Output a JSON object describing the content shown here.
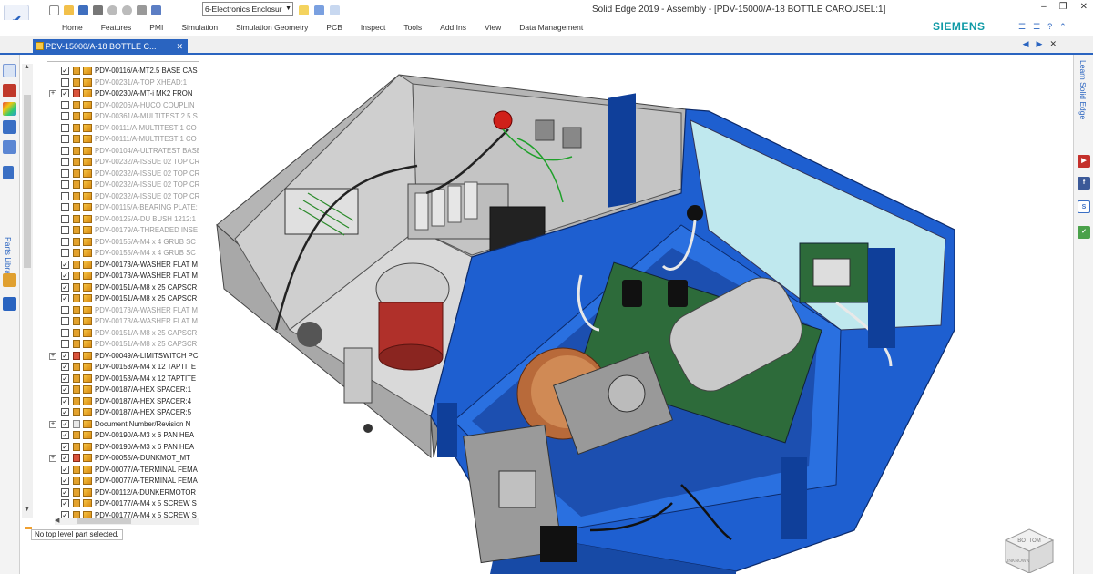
{
  "app": {
    "window_title": "Solid Edge 2019 - Assembly - [PDV-15000/A-18 BOTTLE CAROUSEL:1]",
    "brand": "SIEMENS",
    "environment_select": "6-Electronics Enclosur"
  },
  "ribbon": {
    "tabs": [
      "Home",
      "Features",
      "PMI",
      "Simulation",
      "Simulation Geometry",
      "PCB",
      "Inspect",
      "Tools",
      "Add Ins",
      "View",
      "Data Management"
    ]
  },
  "document_tab": {
    "label": "PDV-15000/A-18 BOTTLE C..."
  },
  "left_panel": {
    "parts_library_label": "Parts Library"
  },
  "right_panel": {
    "learn_label": "Learn Solid Edge"
  },
  "pathfinder": {
    "rows": [
      {
        "label": "PDV-00116/A-MT2.5 BASE CAS",
        "checked": true,
        "gray": false,
        "icon": "part",
        "expand": ""
      },
      {
        "label": "PDV-00231/A-TOP XHEAD:1",
        "checked": false,
        "gray": true,
        "icon": "part",
        "expand": ""
      },
      {
        "label": "PDV-00230/A-MT-i MK2 FRON",
        "checked": true,
        "gray": false,
        "icon": "asm",
        "expand": "+"
      },
      {
        "label": "PDV-00206/A-HUCO COUPLIN",
        "checked": false,
        "gray": true,
        "icon": "part",
        "expand": ""
      },
      {
        "label": "PDV-00361/A-MULTITEST 2.5 S",
        "checked": false,
        "gray": true,
        "icon": "part",
        "expand": ""
      },
      {
        "label": "PDV-00111/A-MULTITEST 1 CO",
        "checked": false,
        "gray": true,
        "icon": "part",
        "expand": ""
      },
      {
        "label": "PDV-00111/A-MULTITEST 1 CO",
        "checked": false,
        "gray": true,
        "icon": "part",
        "expand": ""
      },
      {
        "label": "PDV-00104/A-ULTRATEST BASE",
        "checked": false,
        "gray": true,
        "icon": "part",
        "expand": ""
      },
      {
        "label": "PDV-00232/A-ISSUE 02 TOP CR",
        "checked": false,
        "gray": true,
        "icon": "part",
        "expand": ""
      },
      {
        "label": "PDV-00232/A-ISSUE 02 TOP CR",
        "checked": false,
        "gray": true,
        "icon": "part",
        "expand": ""
      },
      {
        "label": "PDV-00232/A-ISSUE 02 TOP CR",
        "checked": false,
        "gray": true,
        "icon": "part",
        "expand": ""
      },
      {
        "label": "PDV-00232/A-ISSUE 02 TOP CR",
        "checked": false,
        "gray": true,
        "icon": "part",
        "expand": ""
      },
      {
        "label": "PDV-00115/A-BEARING PLATE:",
        "checked": false,
        "gray": true,
        "icon": "part",
        "expand": ""
      },
      {
        "label": "PDV-00125/A-DU BUSH 1212:1",
        "checked": false,
        "gray": true,
        "icon": "part",
        "expand": ""
      },
      {
        "label": "PDV-00179/A-THREADED INSE",
        "checked": false,
        "gray": true,
        "icon": "part",
        "expand": ""
      },
      {
        "label": "PDV-00155/A-M4 x 4 GRUB SC",
        "checked": false,
        "gray": true,
        "icon": "part",
        "expand": ""
      },
      {
        "label": "PDV-00155/A-M4 x 4 GRUB SC",
        "checked": false,
        "gray": true,
        "icon": "part",
        "expand": ""
      },
      {
        "label": "PDV-00173/A-WASHER FLAT M",
        "checked": true,
        "gray": false,
        "icon": "part",
        "expand": ""
      },
      {
        "label": "PDV-00173/A-WASHER FLAT M",
        "checked": true,
        "gray": false,
        "icon": "part",
        "expand": ""
      },
      {
        "label": "PDV-00151/A-M8 x 25 CAPSCR",
        "checked": true,
        "gray": false,
        "icon": "part",
        "expand": ""
      },
      {
        "label": "PDV-00151/A-M8 x 25 CAPSCR",
        "checked": true,
        "gray": false,
        "icon": "part",
        "expand": ""
      },
      {
        "label": "PDV-00173/A-WASHER FLAT M",
        "checked": false,
        "gray": true,
        "icon": "part",
        "expand": ""
      },
      {
        "label": "PDV-00173/A-WASHER FLAT M",
        "checked": false,
        "gray": true,
        "icon": "part",
        "expand": ""
      },
      {
        "label": "PDV-00151/A-M8 x 25 CAPSCR",
        "checked": false,
        "gray": true,
        "icon": "part",
        "expand": ""
      },
      {
        "label": "PDV-00151/A-M8 x 25 CAPSCR",
        "checked": false,
        "gray": true,
        "icon": "part",
        "expand": ""
      },
      {
        "label": "PDV-00049/A-LIMITSWITCH PC",
        "checked": true,
        "gray": false,
        "icon": "asm",
        "expand": "+"
      },
      {
        "label": "PDV-00153/A-M4 x 12 TAPTITE",
        "checked": true,
        "gray": false,
        "icon": "part",
        "expand": ""
      },
      {
        "label": "PDV-00153/A-M4 x 12 TAPTITE",
        "checked": true,
        "gray": false,
        "icon": "part",
        "expand": ""
      },
      {
        "label": "PDV-00187/A-HEX SPACER:1",
        "checked": true,
        "gray": false,
        "icon": "part",
        "expand": ""
      },
      {
        "label": "PDV-00187/A-HEX SPACER:4",
        "checked": true,
        "gray": false,
        "icon": "part",
        "expand": ""
      },
      {
        "label": "PDV-00187/A-HEX SPACER:5",
        "checked": true,
        "gray": false,
        "icon": "part",
        "expand": ""
      },
      {
        "label": "Document Number/Revision N",
        "checked": true,
        "gray": false,
        "icon": "doc",
        "expand": "+"
      },
      {
        "label": "PDV-00190/A-M3 x 6 PAN HEA",
        "checked": true,
        "gray": false,
        "icon": "part",
        "expand": ""
      },
      {
        "label": "PDV-00190/A-M3 x 6 PAN HEA",
        "checked": true,
        "gray": false,
        "icon": "part",
        "expand": ""
      },
      {
        "label": "PDV-00055/A-DUNKMOT_MT",
        "checked": true,
        "gray": false,
        "icon": "asm",
        "expand": "+"
      },
      {
        "label": "PDV-00077/A-TERMINAL FEMA",
        "checked": true,
        "gray": false,
        "icon": "part",
        "expand": ""
      },
      {
        "label": "PDV-00077/A-TERMINAL FEMA",
        "checked": true,
        "gray": false,
        "icon": "part",
        "expand": ""
      },
      {
        "label": "PDV-00112/A-DUNKERMOTOR",
        "checked": true,
        "gray": false,
        "icon": "part",
        "expand": ""
      },
      {
        "label": "PDV-00177/A-M4 x 5 SCREW S",
        "checked": true,
        "gray": false,
        "icon": "part",
        "expand": ""
      },
      {
        "label": "PDV-00177/A-M4 x 5 SCREW S",
        "checked": true,
        "gray": false,
        "icon": "part",
        "expand": ""
      }
    ],
    "status": "No top level part selected."
  },
  "view_cube": {
    "top_label": "BOTTOM",
    "side_label": "UNKNOWN"
  },
  "colors": {
    "accent": "#2a64c0",
    "brand": "#0f9aa6",
    "enclosure_blue": "#1e5fd0",
    "enclosure_gray": "#9a9a9a"
  }
}
